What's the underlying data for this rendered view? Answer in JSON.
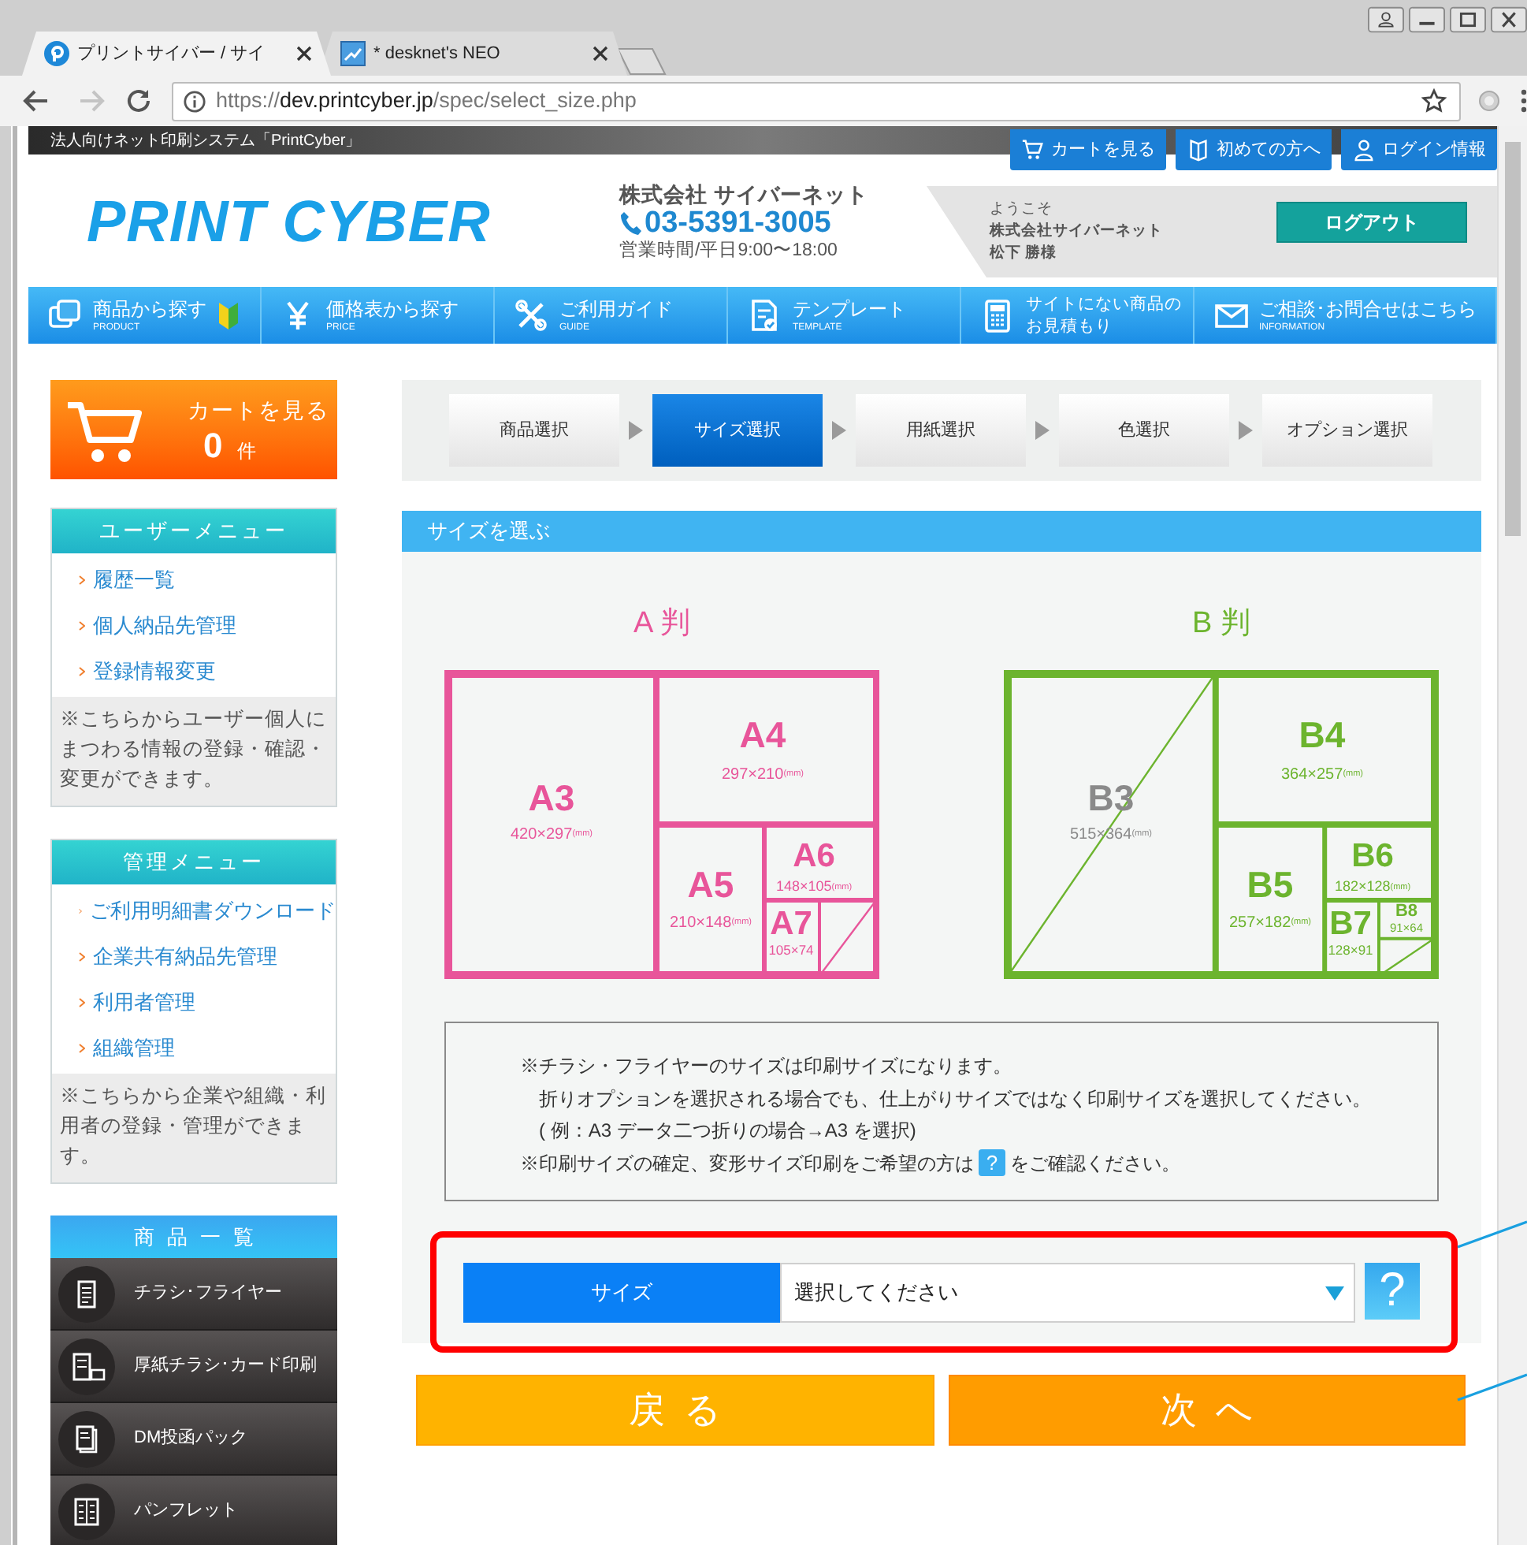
{
  "browser": {
    "tabs": [
      {
        "title": "プリントサイバー / サイ",
        "selected": true
      },
      {
        "title": "* desknet's NEO",
        "selected": false
      }
    ],
    "url_parts": [
      {
        "text": "https://",
        "strong": false
      },
      {
        "text": "dev.printcyber.jp",
        "strong": true
      },
      {
        "text": "/spec/select_size.php",
        "strong": false
      }
    ]
  },
  "header": {
    "tagline": "法人向けネット印刷システム「PrintCyber」",
    "top_links": [
      "カートを見る",
      "初めての方へ",
      "ログイン情報"
    ],
    "logo": "PRINT CYBER",
    "company": {
      "name": "株式会社 サイバーネット",
      "phone": "03-5391-3005",
      "hours": "営業時間/平日9:00〜18:00"
    },
    "welcome": {
      "greeting": "ようこそ",
      "company": "株式会社サイバーネット",
      "user": "松下 勝様",
      "logout": "ログアウト"
    },
    "nav": [
      {
        "label": "商品から探す",
        "sub": "PRODUCT"
      },
      {
        "label": "価格表から探す",
        "sub": "PRICE"
      },
      {
        "label": "ご利用ガイド",
        "sub": "GUIDE"
      },
      {
        "label": "テンプレート",
        "sub": "TEMPLATE"
      },
      {
        "lines": [
          "サイトにない商品の",
          "お見積もり"
        ]
      },
      {
        "label": "ご相談･お問合せはこちら",
        "sub": "INFORMATION"
      }
    ]
  },
  "sidebar": {
    "cart": {
      "label": "カートを見る",
      "count": "0",
      "unit": "件"
    },
    "menus": [
      {
        "title": "ユーザーメニュー",
        "items": [
          "履歴一覧",
          "個人納品先管理",
          "登録情報変更"
        ],
        "note": "※こちらからユーザー個人にまつわる情報の登録・確認・変更ができます。"
      },
      {
        "title": "管理メニュー",
        "items": [
          "ご利用明細書ダウンロード",
          "企業共有納品先管理",
          "利用者管理",
          "組織管理"
        ],
        "note": "※こちらから企業や組織・利用者の登録・管理ができます。"
      }
    ],
    "products": {
      "title": "商品一覧",
      "items": [
        "チラシ･フライヤー",
        "厚紙チラシ･カード印刷",
        "DM投函パック",
        "パンフレット"
      ]
    }
  },
  "main": {
    "steps": [
      {
        "label": "商品選択",
        "selected": false
      },
      {
        "label": "サイズ選択",
        "selected": true
      },
      {
        "label": "用紙選択",
        "selected": false
      },
      {
        "label": "色選択",
        "selected": false
      },
      {
        "label": "オプション選択",
        "selected": false
      }
    ],
    "section_title": "サイズを選ぶ",
    "size_charts": [
      {
        "title": "A 判",
        "color": "#e8559a",
        "cells": [
          {
            "label": "A3",
            "dims": "420×297",
            "unit": "(mm)",
            "muted": false
          },
          {
            "label": "A4",
            "dims": "297×210",
            "unit": "(mm)",
            "muted": false
          },
          {
            "label": "A5",
            "dims": "210×148",
            "unit": "(mm)",
            "muted": false
          },
          {
            "label": "A6",
            "dims": "148×105",
            "unit": "(mm)",
            "muted": false
          },
          {
            "label": "A7",
            "dims": "105×74",
            "muted": false
          }
        ]
      },
      {
        "title": "B 判",
        "color": "#6cb42e",
        "cells": [
          {
            "label": "B3",
            "dims": "515×364",
            "unit": "(mm)",
            "muted": true
          },
          {
            "label": "B4",
            "dims": "364×257",
            "unit": "(mm)",
            "muted": false
          },
          {
            "label": "B5",
            "dims": "257×182",
            "unit": "(mm)",
            "muted": false
          },
          {
            "label": "B6",
            "dims": "182×128",
            "unit": "(mm)",
            "muted": false
          },
          {
            "label": "B7",
            "dims": "128×91",
            "muted": false
          },
          {
            "label": "B8",
            "dims": "91×64",
            "muted": false
          }
        ]
      }
    ],
    "notes": {
      "lines": [
        {
          "text": "※チラシ・フライヤーのサイズは印刷サイズになります。",
          "indent": false
        },
        {
          "text": "折りオプションを選択される場合でも、仕上がりサイズではなく印刷サイズを選択してください。",
          "indent": true
        },
        {
          "text": "( 例：A3 データ二つ折りの場合→A3 を選択)",
          "indent": true
        }
      ],
      "help_line": {
        "before": "※印刷サイズの確定、変形サイズ印刷をご希望の方は",
        "mark": "?",
        "after": "をご確認ください。"
      }
    },
    "size_select": {
      "label": "サイズ",
      "value": "選択してください",
      "help": "?"
    },
    "buttons": [
      "戻る",
      "次へ"
    ]
  }
}
